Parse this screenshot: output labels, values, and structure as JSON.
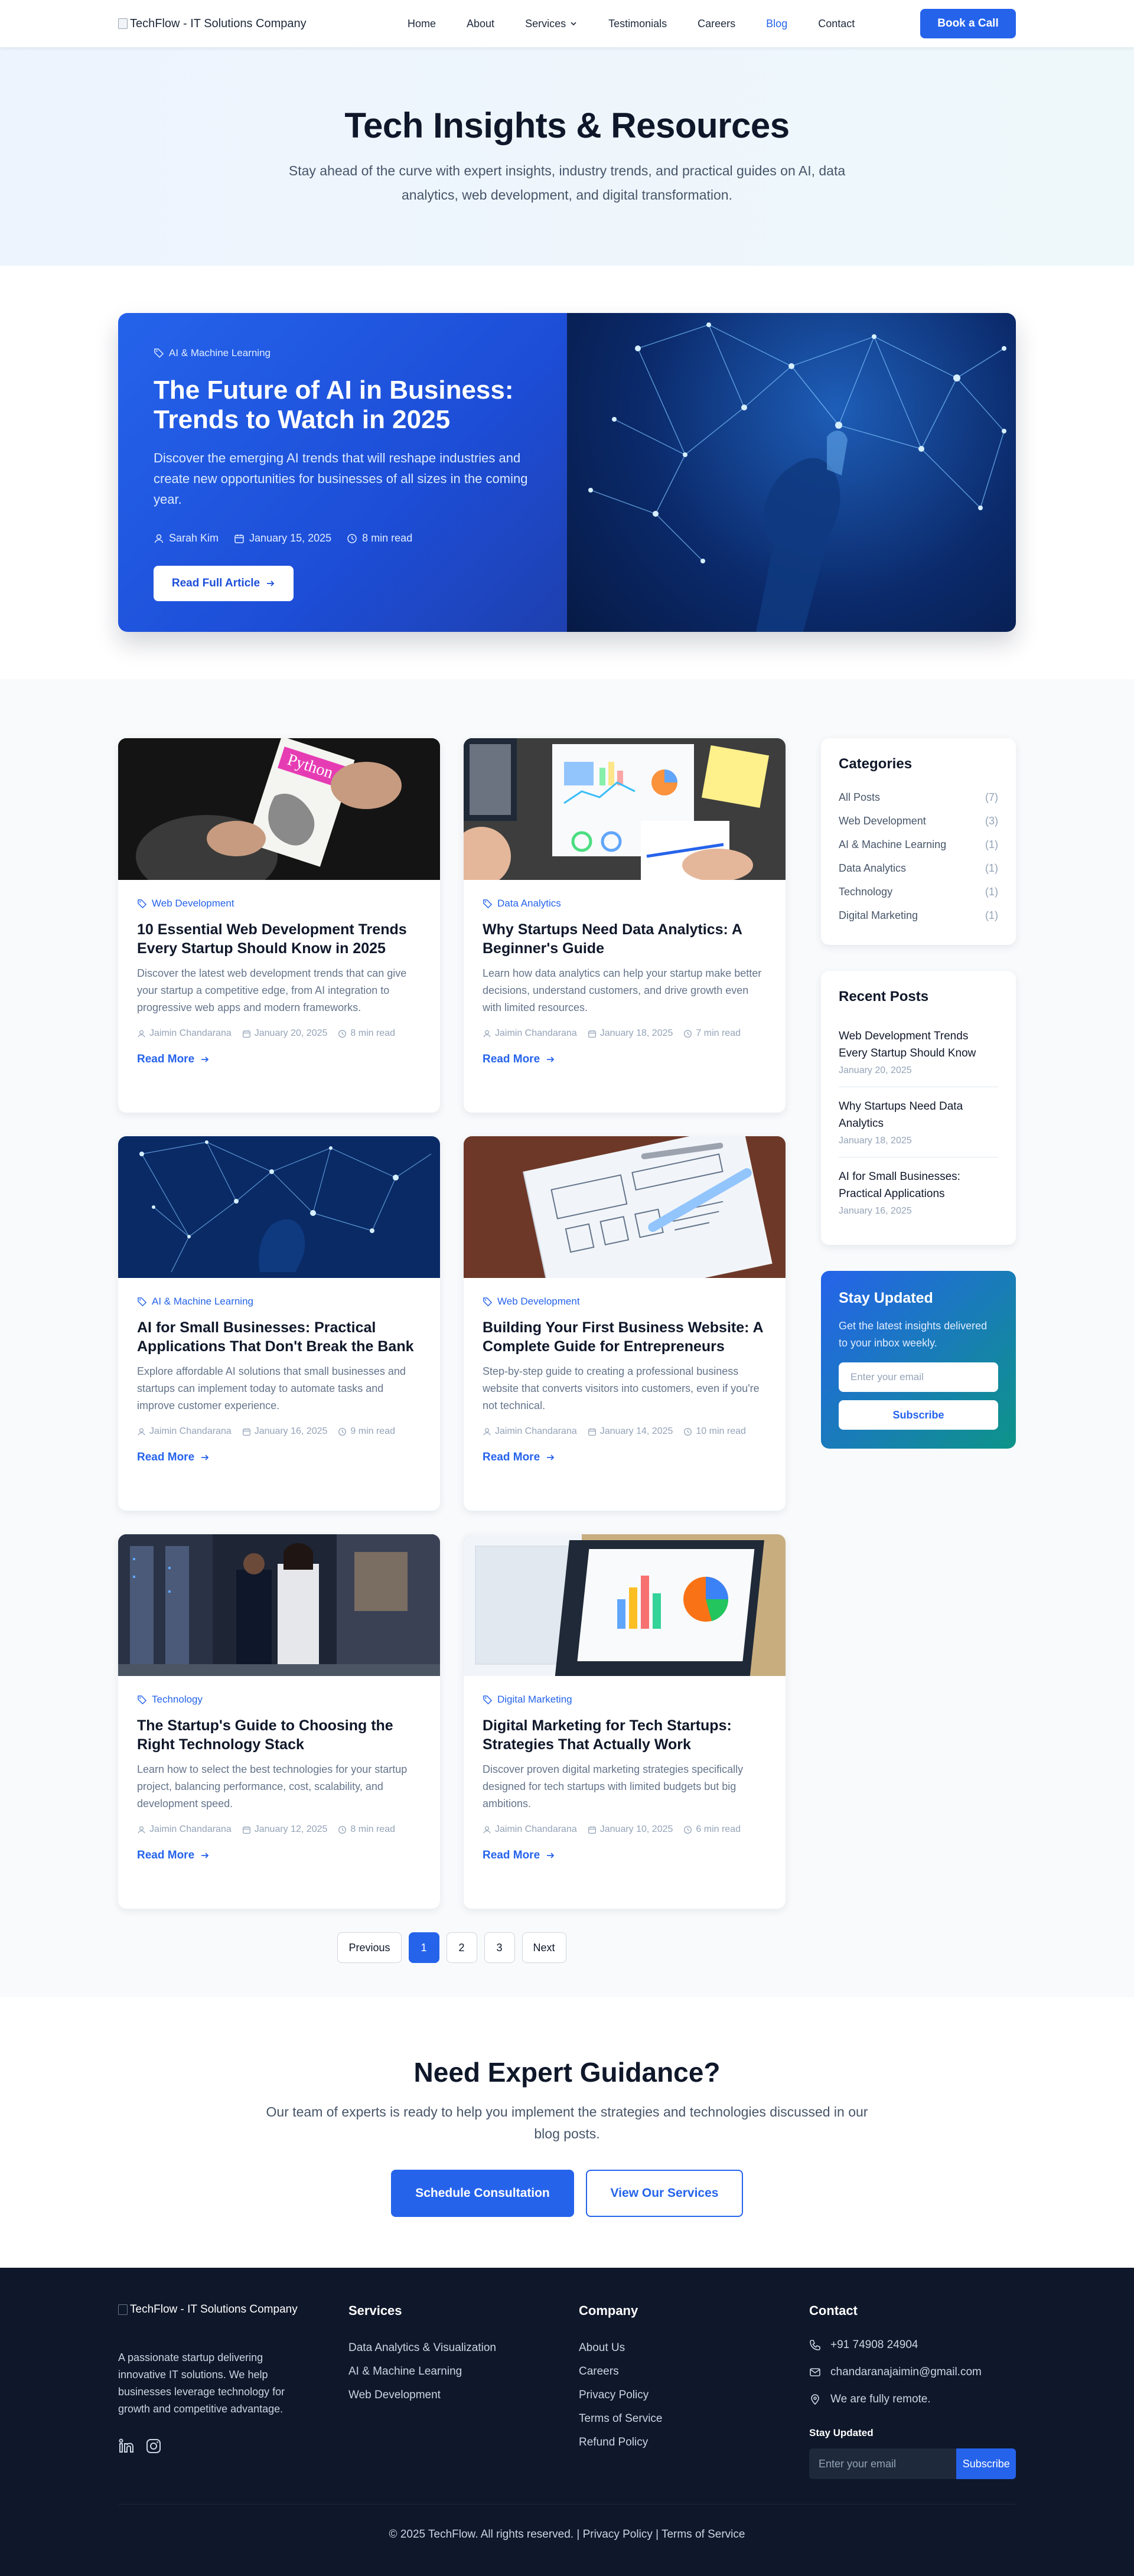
{
  "header": {
    "logo_alt": "TechFlow - IT Solutions Company",
    "nav": [
      "Home",
      "About",
      "Services",
      "Testimonials",
      "Careers",
      "Blog",
      "Contact"
    ],
    "cta": "Book a Call"
  },
  "hero": {
    "title": "Tech Insights & Resources",
    "subtitle": "Stay ahead of the curve with expert insights, industry trends, and practical guides on AI, data analytics, web development, and digital transformation."
  },
  "featured": {
    "category": "AI & Machine Learning",
    "title": "The Future of AI in Business: Trends to Watch in 2025",
    "excerpt": "Discover the emerging AI trends that will reshape industries and create new opportunities for businesses of all sizes in the coming year.",
    "author": "Sarah Kim",
    "date": "January 15, 2025",
    "read_time": "8 min read",
    "button": "Read Full Article"
  },
  "posts": [
    {
      "category": "Web Development",
      "title": "10 Essential Web Development Trends Every Startup Should Know in 2025",
      "excerpt": "Discover the latest web development trends that can give your startup a competitive edge, from AI integration to progressive web apps and modern frameworks.",
      "author": "Jaimin Chandarana",
      "date": "January 20, 2025",
      "read_time": "8 min read",
      "more": "Read More"
    },
    {
      "category": "Data Analytics",
      "title": "Why Startups Need Data Analytics: A Beginner's Guide",
      "excerpt": "Learn how data analytics can help your startup make better decisions, understand customers, and drive growth even with limited resources.",
      "author": "Jaimin Chandarana",
      "date": "January 18, 2025",
      "read_time": "7 min read",
      "more": "Read More"
    },
    {
      "category": "AI & Machine Learning",
      "title": "AI for Small Businesses: Practical Applications That Don't Break the Bank",
      "excerpt": "Explore affordable AI solutions that small businesses and startups can implement today to automate tasks and improve customer experience.",
      "author": "Jaimin Chandarana",
      "date": "January 16, 2025",
      "read_time": "9 min read",
      "more": "Read More"
    },
    {
      "category": "Web Development",
      "title": "Building Your First Business Website: A Complete Guide for Entrepreneurs",
      "excerpt": "Step-by-step guide to creating a professional business website that converts visitors into customers, even if you're not technical.",
      "author": "Jaimin Chandarana",
      "date": "January 14, 2025",
      "read_time": "10 min read",
      "more": "Read More"
    },
    {
      "category": "Technology",
      "title": "The Startup's Guide to Choosing the Right Technology Stack",
      "excerpt": "Learn how to select the best technologies for your startup project, balancing performance, cost, scalability, and development speed.",
      "author": "Jaimin Chandarana",
      "date": "January 12, 2025",
      "read_time": "8 min read",
      "more": "Read More"
    },
    {
      "category": "Digital Marketing",
      "title": "Digital Marketing for Tech Startups: Strategies That Actually Work",
      "excerpt": "Discover proven digital marketing strategies specifically designed for tech startups with limited budgets but big ambitions.",
      "author": "Jaimin Chandarana",
      "date": "January 10, 2025",
      "read_time": "6 min read",
      "more": "Read More"
    }
  ],
  "sidebar": {
    "categories_title": "Categories",
    "categories": [
      {
        "name": "All Posts",
        "count": "(7)"
      },
      {
        "name": "Web Development",
        "count": "(3)"
      },
      {
        "name": "AI & Machine Learning",
        "count": "(1)"
      },
      {
        "name": "Data Analytics",
        "count": "(1)"
      },
      {
        "name": "Technology",
        "count": "(1)"
      },
      {
        "name": "Digital Marketing",
        "count": "(1)"
      }
    ],
    "recent_title": "Recent Posts",
    "recent": [
      {
        "title": "Web Development Trends Every Startup Should Know",
        "date": "January 20, 2025"
      },
      {
        "title": "Why Startups Need Data Analytics",
        "date": "January 18, 2025"
      },
      {
        "title": "AI for Small Businesses: Practical Applications",
        "date": "January 16, 2025"
      }
    ],
    "newsletter": {
      "title": "Stay Updated",
      "text": "Get the latest insights delivered to your inbox weekly.",
      "placeholder": "Enter your email",
      "button": "Subscribe"
    }
  },
  "pagination": {
    "prev": "Previous",
    "pages": [
      "1",
      "2",
      "3"
    ],
    "next": "Next"
  },
  "cta": {
    "title": "Need Expert Guidance?",
    "text": "Our team of experts is ready to help you implement the strategies and technologies discussed in our blog posts.",
    "primary": "Schedule Consultation",
    "secondary": "View Our Services"
  },
  "footer": {
    "logo_alt": "TechFlow - IT Solutions Company",
    "about": "A passionate startup delivering innovative IT solutions. We help businesses leverage technology for growth and competitive advantage.",
    "services_title": "Services",
    "services": [
      "Data Analytics & Visualization",
      "AI & Machine Learning",
      "Web Development"
    ],
    "company_title": "Company",
    "company": [
      "About Us",
      "Careers",
      "Privacy Policy",
      "Terms of Service",
      "Refund Policy"
    ],
    "contact_title": "Contact",
    "phone": "+91 74908 24904",
    "email": "chandaranajaimin@gmail.com",
    "location": "We are fully remote.",
    "stay_label": "Stay Updated",
    "email_placeholder": "Enter your email",
    "subscribe": "Subscribe",
    "copyright": "© 2025 TechFlow. All rights reserved. | Privacy Policy | Terms of Service"
  }
}
